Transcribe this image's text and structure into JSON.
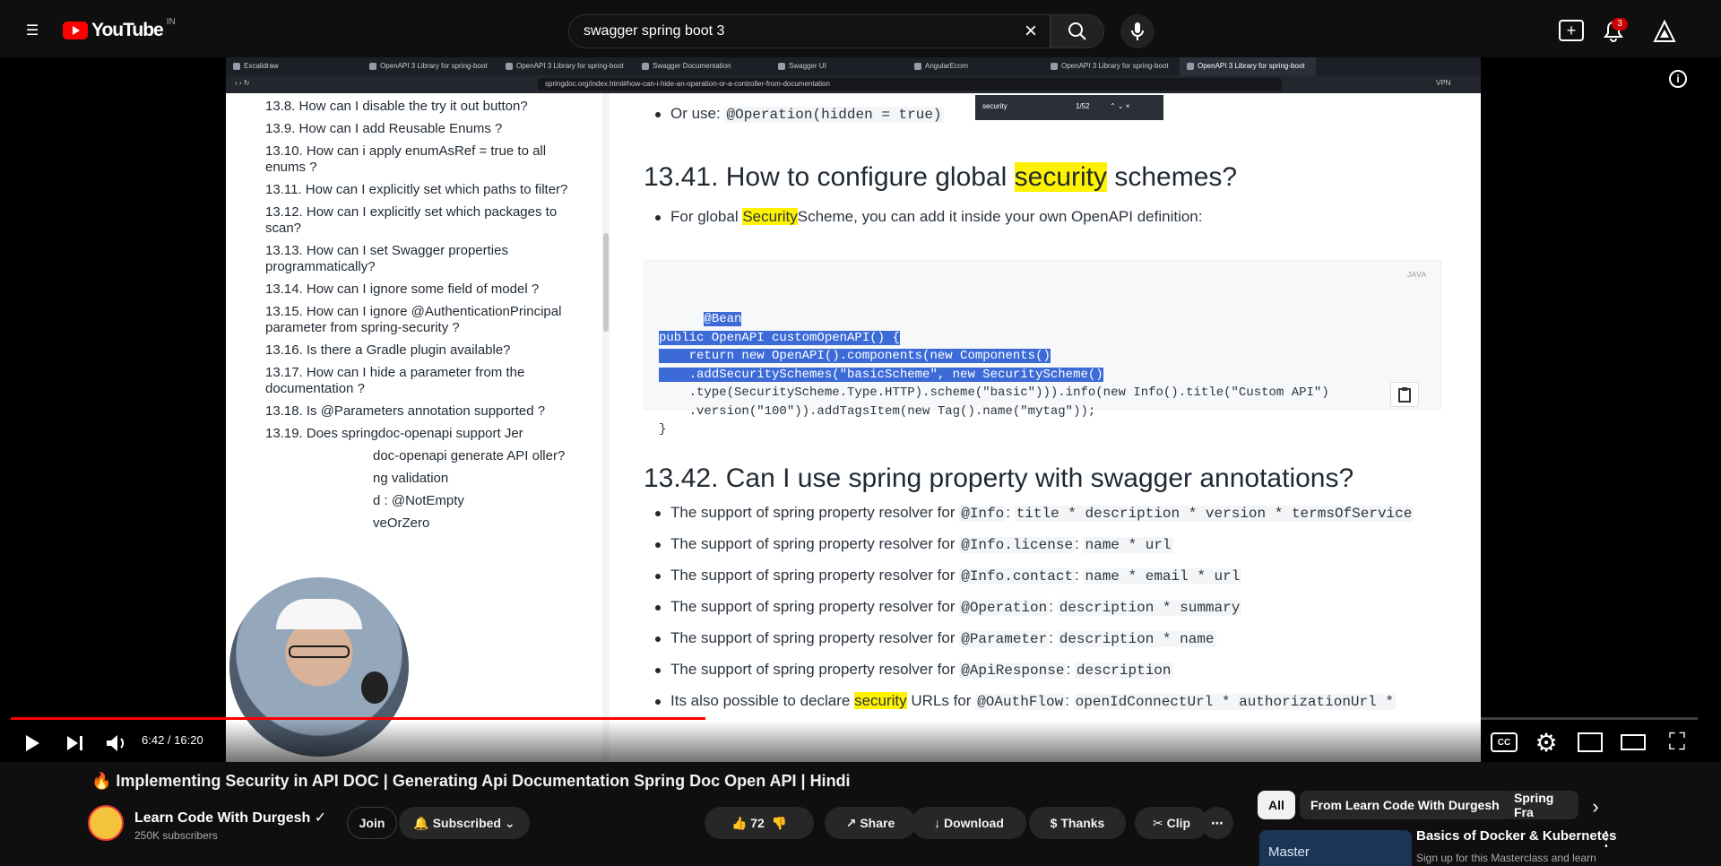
{
  "youtube": {
    "logo": "YouTube",
    "country": "IN",
    "search_value": "swagger spring boot 3",
    "notification_count": "3",
    "icons": {
      "menu": "menu-icon",
      "search": "search-icon",
      "mic": "mic-icon",
      "create": "create-icon",
      "bell": "bell-icon",
      "account": "account-icon"
    }
  },
  "browser": {
    "tabs": [
      "Excalidraw",
      "OpenAPI 3 Library for spring-boot",
      "OpenAPI 3 Library for spring-boot",
      "Swagger Documentation",
      "Swagger UI",
      "AngularEcom",
      "OpenAPI 3 Library for spring-boot",
      "OpenAPI 3 Library for spring-boot"
    ],
    "url": "springdoc.org/index.html#how-can-i-hide-an-operation-or-a-controller-from-documentation",
    "find_text": "security",
    "find_count": "1/52",
    "vpn": "VPN"
  },
  "sidebar": {
    "items": [
      "13.8. How can I disable the try it out button?",
      "13.9. How can I add Reusable Enums ?",
      "13.10. How can i apply enumAsRef = true to all enums ?",
      "13.11. How can I explicitly set which paths to filter?",
      "13.12. How can I explicitly set which packages to scan?",
      "13.13. How can I set Swagger properties programmatically?",
      "13.14. How can I ignore some field of model ?",
      "13.15. How can I ignore @AuthenticationPrincipal parameter from spring-security ?",
      "13.16. Is there a Gradle plugin available?",
      "13.17. How can I hide a parameter from the documentation ?",
      "13.18. Is @Parameters annotation supported ?",
      "13.19. Does springdoc-openapi support Jer",
      "doc-openapi generate API oller?",
      "ng validation",
      "d : @NotEmpty",
      "veOrZero"
    ]
  },
  "content": {
    "top_bullet_prefix": "Or use:",
    "top_bullet_code": "@Operation(hidden = true)",
    "section_1": {
      "num": "13.41.",
      "text_before": "How to configure global",
      "highlight": "security",
      "text_after": "schemes?"
    },
    "section_1_bullet_before": "For global",
    "section_1_bullet_hl": "Security",
    "section_1_bullet_after": "Scheme, you can add it inside your own OpenAPI definition:",
    "code_language": "JAVA",
    "code_lines": [
      "@Bean",
      "public OpenAPI customOpenAPI() {",
      "    return new OpenAPI().components(new Components()",
      "    .addSecuritySchemes(\"basicScheme\", new SecurityScheme()",
      "    .type(SecurityScheme.Type.HTTP).scheme(\"basic\"))).info(new Info().title(\"Custom API\")",
      "    .version(\"100\")).addTagsItem(new Tag().name(\"mytag\"));",
      "}"
    ],
    "section_2": {
      "num": "13.42.",
      "text": "Can I use spring property with swagger annotations?"
    },
    "property_bullets": [
      {
        "text": "The support of spring property resolver for",
        "code": "@Info",
        "props": "title * description * version * termsOfService"
      },
      {
        "text": "The support of spring property resolver for",
        "code": "@Info.license",
        "props": "name * url"
      },
      {
        "text": "The support of spring property resolver for",
        "code": "@Info.contact",
        "props": "name * email * url"
      },
      {
        "text": "The support of spring property resolver for",
        "code": "@Operation",
        "props": "description * summary"
      },
      {
        "text": "The support of spring property resolver for",
        "code": "@Parameter",
        "props": "description * name"
      },
      {
        "text": "The support of spring property resolver for",
        "code": "@ApiResponse",
        "props": "description"
      },
      {
        "text": "Its also possible to declare",
        "hl": "security",
        "after": "URLs for",
        "code": "@OAuthFlow",
        "props": "openIdConnectUrl * authorizationUrl *"
      }
    ]
  },
  "player": {
    "time": "6:42 / 16:20",
    "progress": 0.412,
    "icons": {
      "play": "play-icon",
      "next": "next-icon",
      "volume": "volume-icon",
      "cc": "captions-icon",
      "settings": "settings-icon",
      "miniplayer": "miniplayer-icon",
      "theater": "theater-icon",
      "fullscreen": "fullscreen-icon"
    }
  },
  "video_info": {
    "title": "🔥 Implementing Security in API DOC | Generating Api Documentation Spring Doc Open API | Hindi",
    "channel": "Learn Code With Durgesh",
    "subscribers": "250K subscribers",
    "join": "Join",
    "subscribed": "Subscribed",
    "likes": "72",
    "share": "Share",
    "download": "Download",
    "thanks": "Thanks",
    "clip": "Clip"
  },
  "right_panel": {
    "chips": [
      "All",
      "From Learn Code With Durgesh",
      "Spring Fra"
    ],
    "thumbnail_text": "Master",
    "video_title": "Basics of Docker & Kubernetes",
    "video_subtitle": "Sign up for this Masterclass and learn"
  },
  "colors": {
    "youtube_red": "#ff0000",
    "selection": "#3c6bd8",
    "search_highlight": "#fff200",
    "active_highlight": "#f7a53b"
  }
}
